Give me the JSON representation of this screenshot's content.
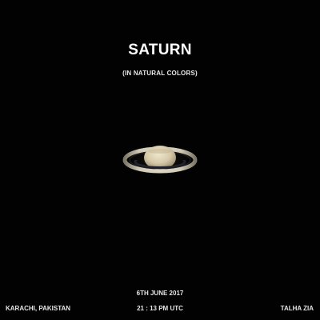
{
  "image": {
    "title": "SATURN",
    "subtitle": "(IN NATURAL COLORS)",
    "date": "6TH JUNE 2017",
    "time": "21 : 13 PM UTC",
    "location": "KARACHI, PAKISTAN",
    "author": "TALHA ZIA"
  },
  "colors": {
    "background": "#020202",
    "ring": "#c9c2b0",
    "ring_shadow": "#2a2a33",
    "planet_body": "#d8cfb4",
    "planet_band": "#b9ab8a"
  }
}
